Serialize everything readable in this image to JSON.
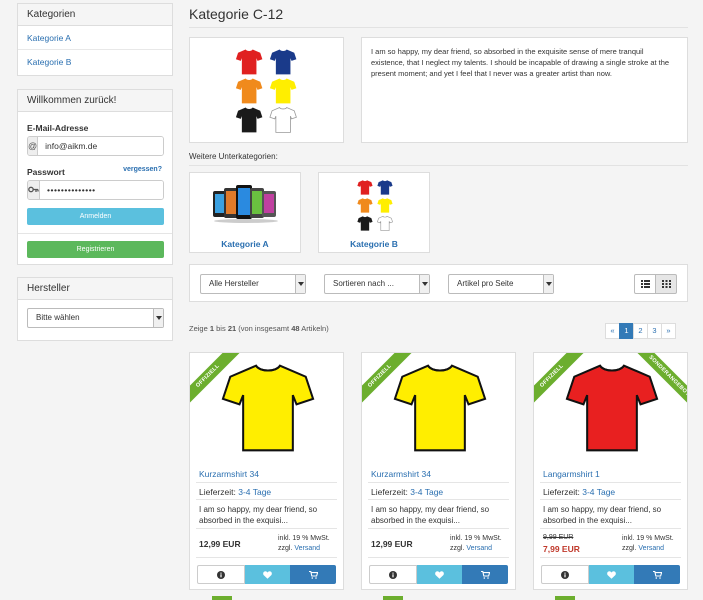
{
  "sidebar": {
    "categories": {
      "title": "Kategorien",
      "items": [
        {
          "label": "Kategorie A"
        },
        {
          "label": "Kategorie B"
        }
      ]
    },
    "login": {
      "title": "Willkommen zurück!",
      "email_label": "E-Mail-Adresse",
      "email_value": "info@aikm.de",
      "password_label": "Passwort",
      "forgot_label": "vergessen?",
      "password_value": "••••••••••••••",
      "login_button": "Anmelden",
      "register_button": "Registrieren"
    },
    "manufacturer": {
      "title": "Hersteller",
      "select_value": "Bitte wählen"
    }
  },
  "main": {
    "title": "Kategorie C-12",
    "description": "I am so happy, my dear friend, so absorbed in the exquisite sense of mere tranquil existence, that I neglect my talents. I should be incapable of drawing a single stroke at the present moment; and yet I feel that I never was a greater artist than now.",
    "subcategories_label": "Weitere Unterkategorien:",
    "subcategories": [
      {
        "label": "Kategorie A"
      },
      {
        "label": "Kategorie B"
      }
    ],
    "filters": {
      "manufacturer": "Alle Hersteller",
      "sort": "Sortieren nach ...",
      "per_page": "Artikel pro Seite"
    },
    "results": {
      "prefix": "Zeige",
      "from": "1",
      "to_word": "bis",
      "to": "21",
      "total_prefix": "(von insgesamt",
      "total": "48",
      "total_suffix": "Artikeln)"
    },
    "pagination": [
      "«",
      "1",
      "2",
      "3",
      "»"
    ],
    "products": [
      {
        "ribbon_left": "OFFIZIELL",
        "name": "Kurzarmshirt 34",
        "delivery_label": "Lieferzeit:",
        "delivery_value": "3-4 Tage",
        "description": "I am so happy, my dear friend, so absorbed in the exquisi...",
        "price": "12,99 EUR",
        "tax": "inkl. 19 % MwSt.",
        "shipping_prefix": "zzgl.",
        "shipping_link": "Versand",
        "shirt_color": "#ffee00"
      },
      {
        "ribbon_left": "OFFIZIELL",
        "name": "Kurzarmshirt 34",
        "delivery_label": "Lieferzeit:",
        "delivery_value": "3-4 Tage",
        "description": "I am so happy, my dear friend, so absorbed in the exquisi...",
        "price": "12,99 EUR",
        "tax": "inkl. 19 % MwSt.",
        "shipping_prefix": "zzgl.",
        "shipping_link": "Versand",
        "shirt_color": "#ffee00"
      },
      {
        "ribbon_left": "OFFIZIELL",
        "ribbon_right": "SONDERANGEBOT",
        "name": "Langarmshirt 1",
        "delivery_label": "Lieferzeit:",
        "delivery_value": "3-4 Tage",
        "description": "I am so happy, my dear friend, so absorbed in the exquisi...",
        "old_price": "9,99 EUR",
        "sale_price": "7,99 EUR",
        "tax": "inkl. 19 % MwSt.",
        "shipping_prefix": "zzgl.",
        "shipping_link": "Versand",
        "shirt_color": "#e82020"
      }
    ]
  }
}
